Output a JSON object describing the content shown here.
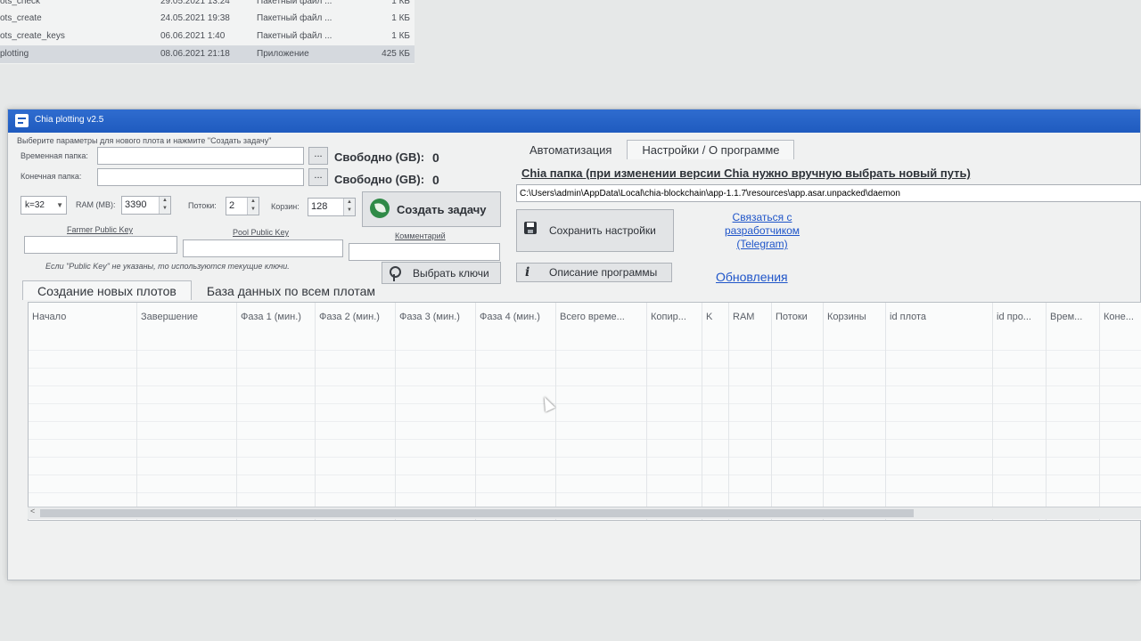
{
  "explorer": {
    "rows": [
      {
        "name": "ots_check",
        "date": "29.05.2021 13:24",
        "type": "Пакетный файл ...",
        "size": "1 КБ"
      },
      {
        "name": "ots_create",
        "date": "24.05.2021 19:38",
        "type": "Пакетный файл ...",
        "size": "1 КБ"
      },
      {
        "name": "ots_create_keys",
        "date": "06.06.2021 1:40",
        "type": "Пакетный файл ...",
        "size": "1 КБ"
      },
      {
        "name": "plotting",
        "date": "08.06.2021 21:18",
        "type": "Приложение",
        "size": "425 КБ"
      }
    ]
  },
  "window": {
    "title": "Chia plotting v2.5"
  },
  "left": {
    "instruction": "Выберите параметры для нового плота и нажмите \"Создать задачу\"",
    "temp_label": "Временная папка:",
    "final_label": "Конечная папка:",
    "browse_label": "...",
    "free_label": "Свободно (GB):",
    "temp_free": "0",
    "final_free": "0",
    "k_value": "k=32",
    "ram_label": "RAM (MB):",
    "ram_value": "3390",
    "threads_label": "Потоки:",
    "threads_value": "2",
    "buckets_label": "Корзин:",
    "buckets_value": "128",
    "create_task": "Создать задачу",
    "farmer_key_label": "Farmer Public Key",
    "pool_key_label": "Pool Public Key",
    "comment_label": "Комментарий",
    "keys_hint": "Если \"Public Key\" не указаны, то используются текущие ключи.",
    "choose_keys": "Выбрать ключи"
  },
  "right": {
    "tabs": [
      "Автоматизация",
      "Настройки / О программе"
    ],
    "chia_folder_label": "Chia папка (при изменении версии Chia нужно вручную выбрать новый путь)",
    "chia_path": "C:\\Users\\admin\\AppData\\Local\\chia-blockchain\\app-1.1.7\\resources\\app.asar.unpacked\\daemon",
    "save_settings": "Сохранить настройки",
    "contact_dev": "Связаться с разработчиком (Telegram)",
    "description": "Описание программы",
    "updates": "Обновления"
  },
  "bottom_tabs": [
    "Создание новых плотов",
    "База данных по всем плотам"
  ],
  "grid": {
    "columns": [
      "Начало",
      "Завершение",
      "Фаза 1 (мин.)",
      "Фаза 2 (мин.)",
      "Фаза 3 (мин.)",
      "Фаза 4 (мин.)",
      "Всего време...",
      "Копир...",
      "K",
      "RAM",
      "Потоки",
      "Корзины",
      "id плота",
      "id про...",
      "Врем...",
      "Коне..."
    ]
  }
}
